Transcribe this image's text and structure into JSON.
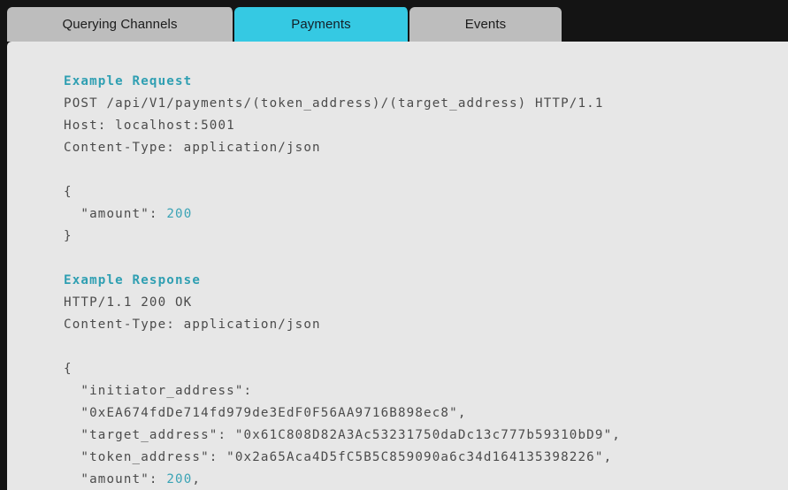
{
  "colors": {
    "window_bg": "#141414",
    "panel_bg": "#e7e7e7",
    "tab_inactive_bg": "#bdbdbd",
    "tab_active_bg": "#35c9e3",
    "code_text": "#4b4b4b",
    "heading_accent": "#2f9fb2",
    "number_accent": "#3aa3b5"
  },
  "tabs": [
    {
      "label": "Querying Channels",
      "active": false
    },
    {
      "label": "Payments",
      "active": true
    },
    {
      "label": "Events",
      "active": false
    }
  ],
  "content": {
    "request_heading": "Example Request",
    "request_lines": [
      "POST /api/V1/payments/(token_address)/(target_address) HTTP/1.1",
      "Host: localhost:5001",
      "Content-Type: application/json"
    ],
    "request_body": {
      "open_brace": "{",
      "amount_key": "  \"amount\": ",
      "amount_value": "200",
      "close_brace": "}"
    },
    "response_heading": "Example Response",
    "response_lines": [
      "HTTP/1.1 200 OK",
      "Content-Type: application/json"
    ],
    "response_body": {
      "open_brace": "{",
      "initiator_key": "  \"initiator_address\": ",
      "initiator_value": "  \"0xEA674fdDe714fd979de3EdF0F56AA9716B898ec8\",",
      "target_line": "  \"target_address\": \"0x61C808D82A3Ac53231750daDc13c777b59310bD9\",",
      "token_line": "  \"token_address\": \"0x2a65Aca4D5fC5B5C859090a6c34d164135398226\",",
      "amount_key": "  \"amount\": ",
      "amount_value": "200",
      "amount_comma": ","
    }
  }
}
